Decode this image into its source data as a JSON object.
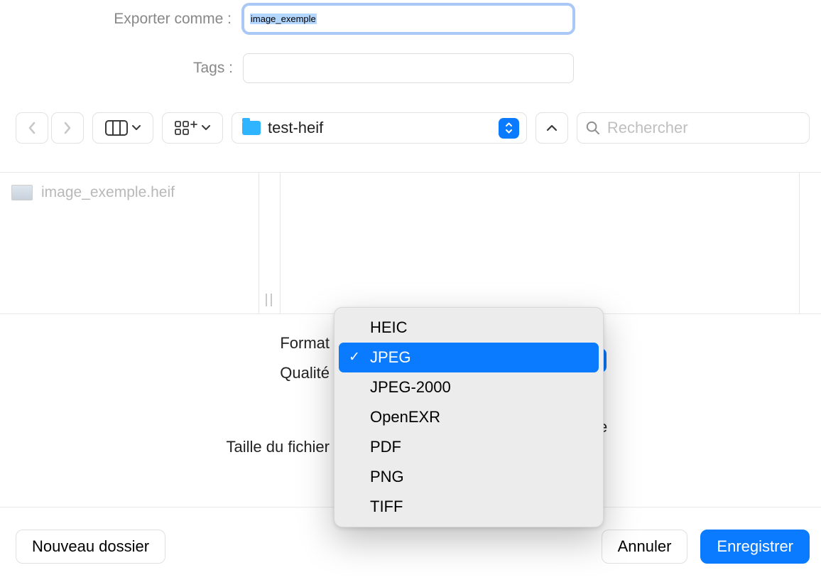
{
  "labels": {
    "export_as": "Exporter comme :",
    "tags": "Tags :",
    "format": "Format",
    "quality": "Qualité",
    "filesize": "Taille du fichier"
  },
  "filename": "image_exemple",
  "location": "test-heif",
  "search_placeholder": "Rechercher",
  "file_in_list": "image_exemple.heif",
  "format_options": {
    "0": "HEIC",
    "1": "JPEG",
    "2": "JPEG-2000",
    "3": "OpenEXR",
    "4": "PDF",
    "5": "PNG",
    "6": "TIFF"
  },
  "selected_format_index": 1,
  "buttons": {
    "new_folder": "Nouveau dossier",
    "cancel": "Annuler",
    "save": "Enregistrer"
  },
  "hint_e": "e"
}
